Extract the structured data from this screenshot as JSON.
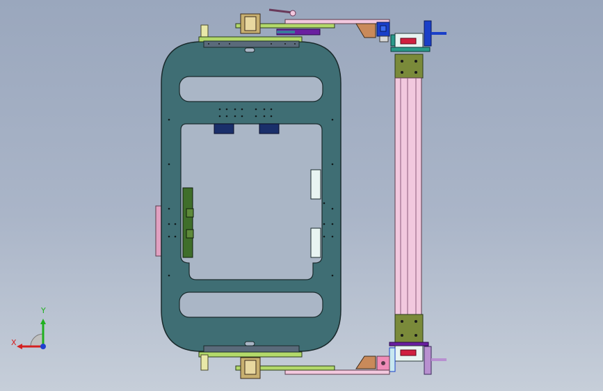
{
  "viewport": {
    "background_top": "#9aa7bd",
    "background_bottom": "#c6ced9"
  },
  "colors": {
    "frame": "#3f6e74",
    "frame_stroke": "#1a2a2c",
    "cutout": "#aab6c6",
    "green_plate": "#b3d96a",
    "dark_green": "#3f6e2a",
    "olive": "#7a8a3a",
    "blue_block": "#1a3fc8",
    "pink": "#e0a0c0",
    "light_pink": "#f2c8de",
    "purple": "#6a1fa0",
    "teal": "#2a9a8a",
    "brown": "#c98a5a",
    "navy_pad": "#1a2f6a",
    "white_pad": "#e8f4f2"
  },
  "triad": {
    "x_label": "X",
    "y_label": "Y",
    "x_color": "#d42020",
    "y_color": "#20b020",
    "z_color": "#2040d0"
  }
}
